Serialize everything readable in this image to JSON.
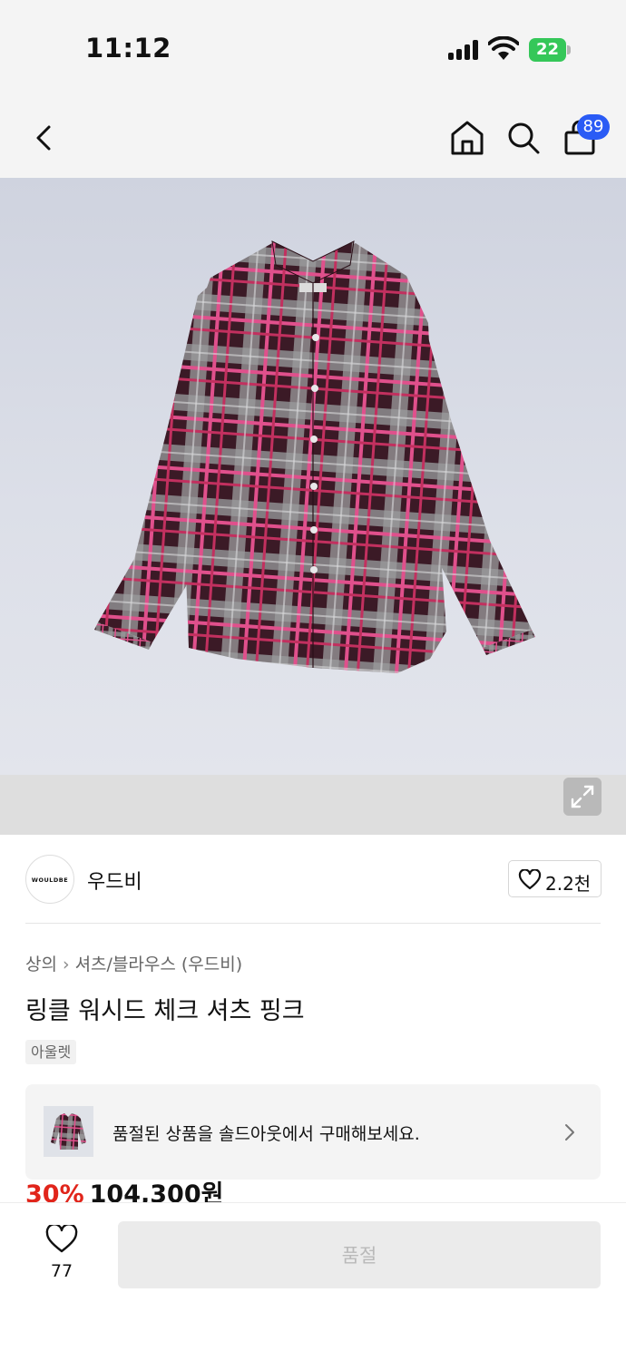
{
  "status_bar": {
    "time": "11:12",
    "battery": "22"
  },
  "nav": {
    "icons": [
      "chevron-left-icon",
      "home-icon",
      "search-icon",
      "shopping-bag-icon"
    ],
    "cart_badge": "89"
  },
  "gallery": {
    "image": "plaid-shirt-product-photo",
    "expand_icon": "expand-icon"
  },
  "brand": {
    "logo_text": "WOULDBE",
    "name": "우드비",
    "like_count": "2.2천"
  },
  "product": {
    "breadcrumb": [
      "상의",
      "셔츠/블라우스 (우드비)"
    ],
    "title": "링클 워시드 체크 셔츠 핑크",
    "tag": "아울렛",
    "discount": "30%",
    "price": "104,300원"
  },
  "soldout_banner": {
    "text": "품절된 상품을 솔드아웃에서 구매해보세요."
  },
  "bottom_bar": {
    "like_count": "77",
    "buy_label": "품절"
  },
  "colors": {
    "accent_blue": "#2a5bf5",
    "discount_red": "#e1251b",
    "battery_green": "#35c759"
  }
}
